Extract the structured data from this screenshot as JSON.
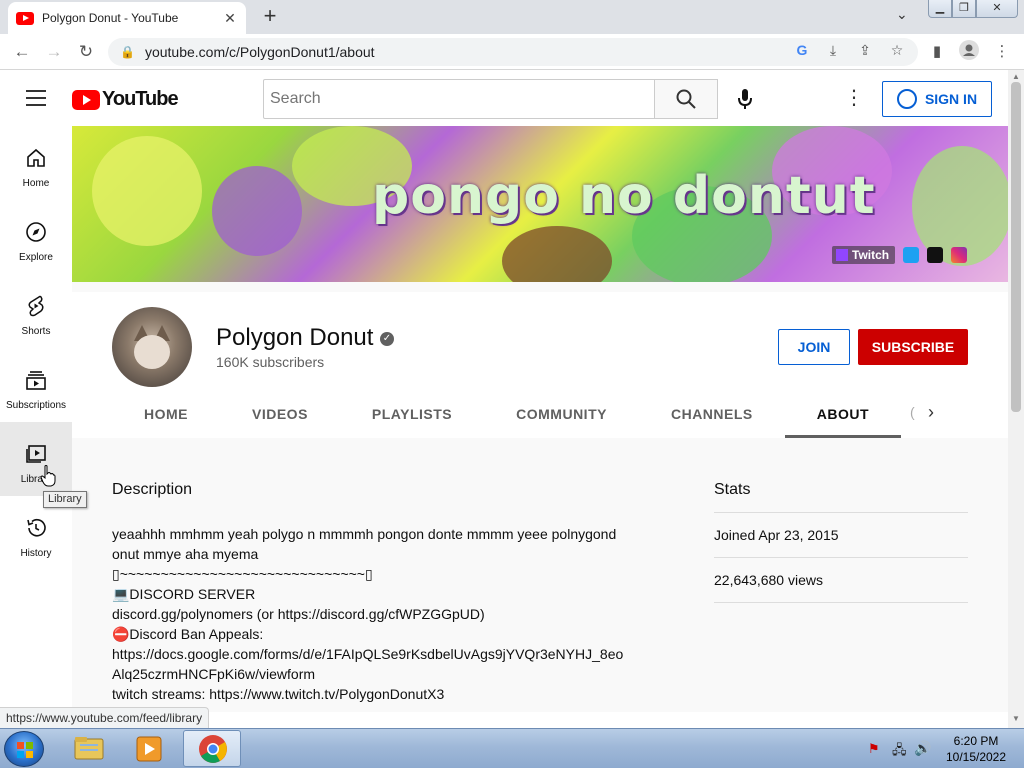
{
  "browser": {
    "tab_title": "Polygon Donut - YouTube",
    "url": "youtube.com/c/PolygonDonut1/about",
    "status_url": "https://www.youtube.com/feed/library"
  },
  "youtube": {
    "logo_text": "YouTube",
    "search_placeholder": "Search",
    "signin_label": "SIGN IN",
    "guide": [
      {
        "label": "Home",
        "icon": "home-icon"
      },
      {
        "label": "Explore",
        "icon": "compass-icon"
      },
      {
        "label": "Shorts",
        "icon": "shorts-icon"
      },
      {
        "label": "Subscriptions",
        "icon": "subscriptions-icon"
      },
      {
        "label": "Library",
        "icon": "library-icon"
      },
      {
        "label": "History",
        "icon": "history-icon"
      }
    ],
    "tooltip": "Library"
  },
  "channel": {
    "banner_text": "pongo no dontut",
    "banner_link_twitch": "Twitch",
    "name": "Polygon Donut",
    "subscribers": "160K subscribers",
    "join_label": "JOIN",
    "subscribe_label": "SUBSCRIBE",
    "tabs": [
      "HOME",
      "VIDEOS",
      "PLAYLISTS",
      "COMMUNITY",
      "CHANNELS",
      "ABOUT"
    ],
    "active_tab": "ABOUT"
  },
  "about": {
    "description_heading": "Description",
    "description_lines": [
      "yeaahhh mmhmm yeah polygo n mmmmh pongon donte mmmm yeee polnygond onut mmye aha myema",
      "▯~~~~~~~~~~~~~~~~~~~~~~~~~~~~~~▯",
      "💻DISCORD SERVER",
      "discord.gg/polynomers (or https://discord.gg/cfWPZGGpUD)",
      "⛔Discord Ban Appeals:",
      "https://docs.google.com/forms/d/e/1FAIpQLSe9rKsdbelUvAgs9jYVQr3eNYHJ_8eoAlq25czrmHNCFpKi6w/viewform",
      "",
      "twitch streams: https://www.twitch.tv/PolygonDonutX3"
    ],
    "stats_heading": "Stats",
    "joined": "Joined Apr 23, 2015",
    "views": "22,643,680 views"
  },
  "taskbar": {
    "time": "6:20 PM",
    "date": "10/15/2022"
  },
  "colors": {
    "youtube_red": "#ff0000",
    "subscribe_red": "#cc0000",
    "link_blue": "#065fd4"
  }
}
